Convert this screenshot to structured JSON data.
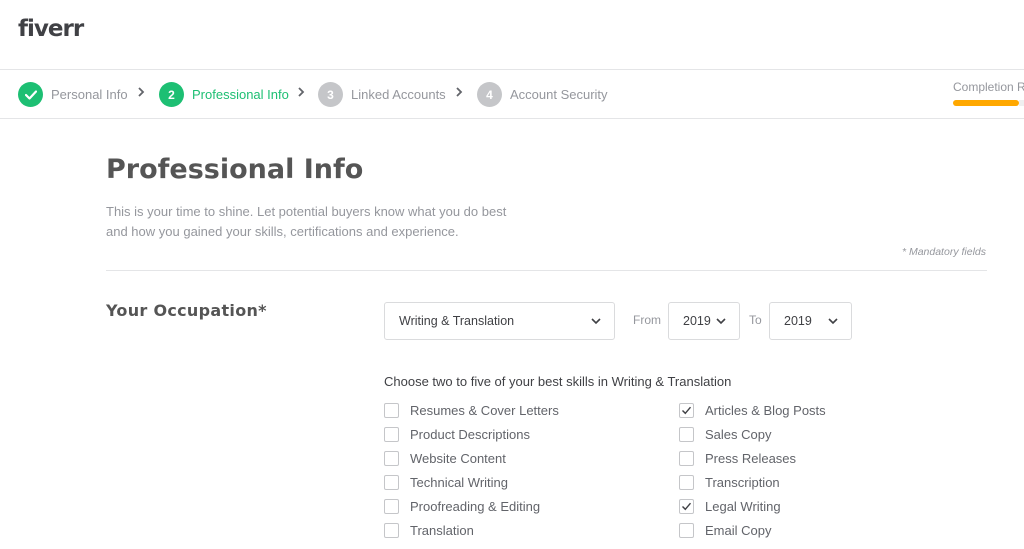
{
  "header": {
    "logo": "fiverr"
  },
  "steps": [
    {
      "label": "Personal Info",
      "number": "✓",
      "state": "done"
    },
    {
      "label": "Professional Info",
      "number": "2",
      "state": "active"
    },
    {
      "label": "Linked Accounts",
      "number": "3",
      "state": "pending"
    },
    {
      "label": "Account Security",
      "number": "4",
      "state": "pending"
    }
  ],
  "completion": {
    "label": "Completion R",
    "accent": "#ffa800"
  },
  "page": {
    "title": "Professional Info",
    "desc_line1": "This is your time to shine. Let potential buyers know what you do best",
    "desc_line2": "and how you gained your skills, certifications and experience.",
    "mandatory": "* Mandatory fields"
  },
  "occupation": {
    "label": "Your Occupation*",
    "category": "Writing & Translation",
    "from_label": "From",
    "from_value": "2019",
    "to_label": "To",
    "to_value": "2019"
  },
  "skills": {
    "title": "Choose two to five of your best skills in Writing & Translation",
    "left": [
      {
        "label": "Resumes & Cover Letters",
        "checked": false
      },
      {
        "label": "Product Descriptions",
        "checked": false
      },
      {
        "label": "Website Content",
        "checked": false
      },
      {
        "label": "Technical Writing",
        "checked": false
      },
      {
        "label": "Proofreading & Editing",
        "checked": false
      },
      {
        "label": "Translation",
        "checked": false
      }
    ],
    "right": [
      {
        "label": "Articles & Blog Posts",
        "checked": true
      },
      {
        "label": "Sales Copy",
        "checked": false
      },
      {
        "label": "Press Releases",
        "checked": false
      },
      {
        "label": "Transcription",
        "checked": false
      },
      {
        "label": "Legal Writing",
        "checked": true
      },
      {
        "label": "Email Copy",
        "checked": false
      }
    ]
  },
  "colors": {
    "brand_green": "#1dbf73",
    "text": "#404145",
    "muted": "#95979d"
  }
}
